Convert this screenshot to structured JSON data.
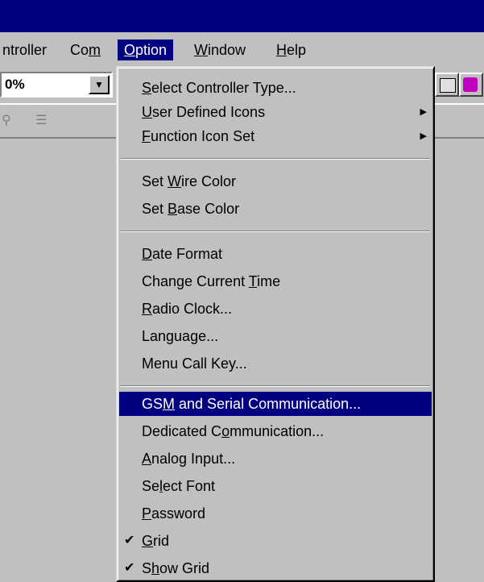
{
  "menubar": {
    "items": [
      {
        "label": "ntroller",
        "ul_before": "",
        "ul": "",
        "ul_after": ""
      },
      {
        "label": "",
        "ul_before": "Co",
        "ul": "m",
        "ul_after": ""
      },
      {
        "label": "",
        "ul_before": "",
        "ul": "O",
        "ul_after": "ption"
      },
      {
        "label": "",
        "ul_before": "",
        "ul": "W",
        "ul_after": "indow"
      },
      {
        "label": "",
        "ul_before": "",
        "ul": "H",
        "ul_after": "elp"
      }
    ]
  },
  "toolbar": {
    "zoom_value": "0%",
    "zoom_arrow": "▼"
  },
  "option_menu": {
    "items": [
      {
        "pre": "",
        "ul": "S",
        "post": "elect Controller Type...",
        "submenu": ""
      },
      {
        "pre": "",
        "ul": "U",
        "post": "ser Defined Icons",
        "submenu": "▶"
      },
      {
        "pre": "",
        "ul": "F",
        "post": "unction Icon Set",
        "submenu": "▶"
      },
      {
        "pre": "Set ",
        "ul": "W",
        "post": "ire Color",
        "submenu": ""
      },
      {
        "pre": "Set ",
        "ul": "B",
        "post": "ase Color",
        "submenu": ""
      },
      {
        "pre": "",
        "ul": "D",
        "post": "ate Format",
        "submenu": ""
      },
      {
        "pre": "Change Current ",
        "ul": "T",
        "post": "ime",
        "submenu": ""
      },
      {
        "pre": "",
        "ul": "R",
        "post": "adio Clock...",
        "submenu": ""
      },
      {
        "pre": "Language...",
        "ul": "",
        "post": "",
        "submenu": ""
      },
      {
        "pre": "Menu Call Key...",
        "ul": "",
        "post": "",
        "submenu": ""
      },
      {
        "pre": "GS",
        "ul": "M",
        "post": " and Serial Communication...",
        "submenu": ""
      },
      {
        "pre": "Dedicated C",
        "ul": "o",
        "post": "mmunication...",
        "submenu": ""
      },
      {
        "pre": "",
        "ul": "A",
        "post": "nalog Input...",
        "submenu": ""
      },
      {
        "pre": "Se",
        "ul": "l",
        "post": "ect Font",
        "submenu": ""
      },
      {
        "pre": "",
        "ul": "P",
        "post": "assword",
        "submenu": ""
      },
      {
        "pre": "",
        "ul": "G",
        "post": "rid",
        "submenu": "",
        "check": "✔"
      },
      {
        "pre": "S",
        "ul": "h",
        "post": "ow Grid",
        "submenu": "",
        "check": "✔"
      }
    ]
  }
}
